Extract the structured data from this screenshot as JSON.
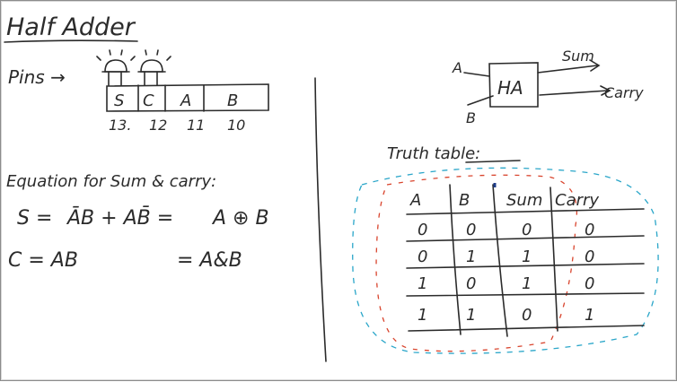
{
  "title": "Half Adder",
  "pins": {
    "label": "Pins →",
    "letters": [
      "S",
      "C",
      "A",
      "B"
    ],
    "numbers": [
      "13.",
      "12",
      "11",
      "10"
    ]
  },
  "equation": {
    "heading": "Equation for Sum & carry:",
    "sum_lhs": "S = ",
    "sum_rhs": "ĀB + AB̄ = ",
    "sum_xor": "A ⊕ B",
    "carry_lhs": "C = AB",
    "carry_rhs": "= A&B"
  },
  "block": {
    "label": "HA",
    "in_a": "A",
    "in_b": "B",
    "out_sum": "Sum",
    "out_carry": "Carry"
  },
  "truth_table": {
    "title": "Truth table:",
    "headers": [
      "A",
      "B",
      "Sum",
      "Carry"
    ],
    "rows": [
      [
        "0",
        "0",
        "0",
        "0"
      ],
      [
        "0",
        "1",
        "1",
        "0"
      ],
      [
        "1",
        "0",
        "1",
        "0"
      ],
      [
        "1",
        "1",
        "0",
        "1"
      ]
    ]
  },
  "colors": {
    "ink": "#2b2b2b",
    "dash_blue": "#2aa6c9",
    "dash_red": "#d9452e"
  }
}
